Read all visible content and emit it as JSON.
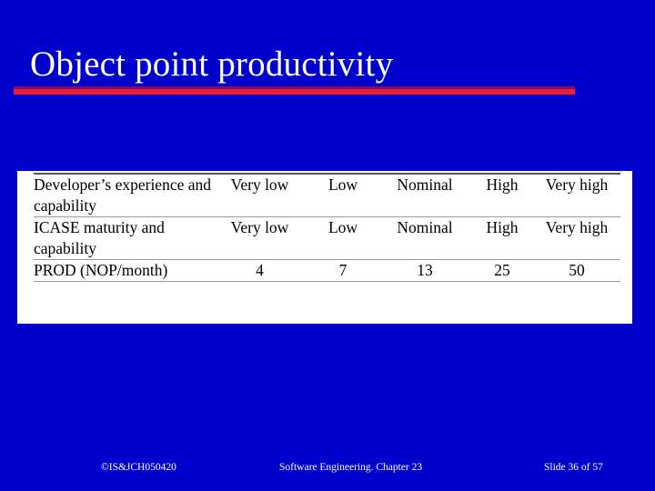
{
  "slide": {
    "title": "Object point productivity",
    "background_color": "#0000CC",
    "title_color": "#FFFFFF",
    "accent_rule_color": "#E8203C",
    "accent_rule_shadow_color": "#8C0A5A"
  },
  "table": {
    "rows": [
      {
        "label": "Developer’s experience and capability",
        "values": [
          "Very low",
          "Low",
          "Nominal",
          "High",
          "Very high"
        ]
      },
      {
        "label": "ICASE maturity and capability",
        "values": [
          "Very low",
          "Low",
          "Nominal",
          "High",
          "Very high"
        ]
      },
      {
        "label": "PROD (NOP/month)",
        "values": [
          "4",
          "7",
          "13",
          "25",
          "50"
        ]
      }
    ]
  },
  "footer": {
    "left": "©IS&JCH050420",
    "center": "Software Engineering. Chapter 23",
    "right": "Slide 36 of 57"
  }
}
